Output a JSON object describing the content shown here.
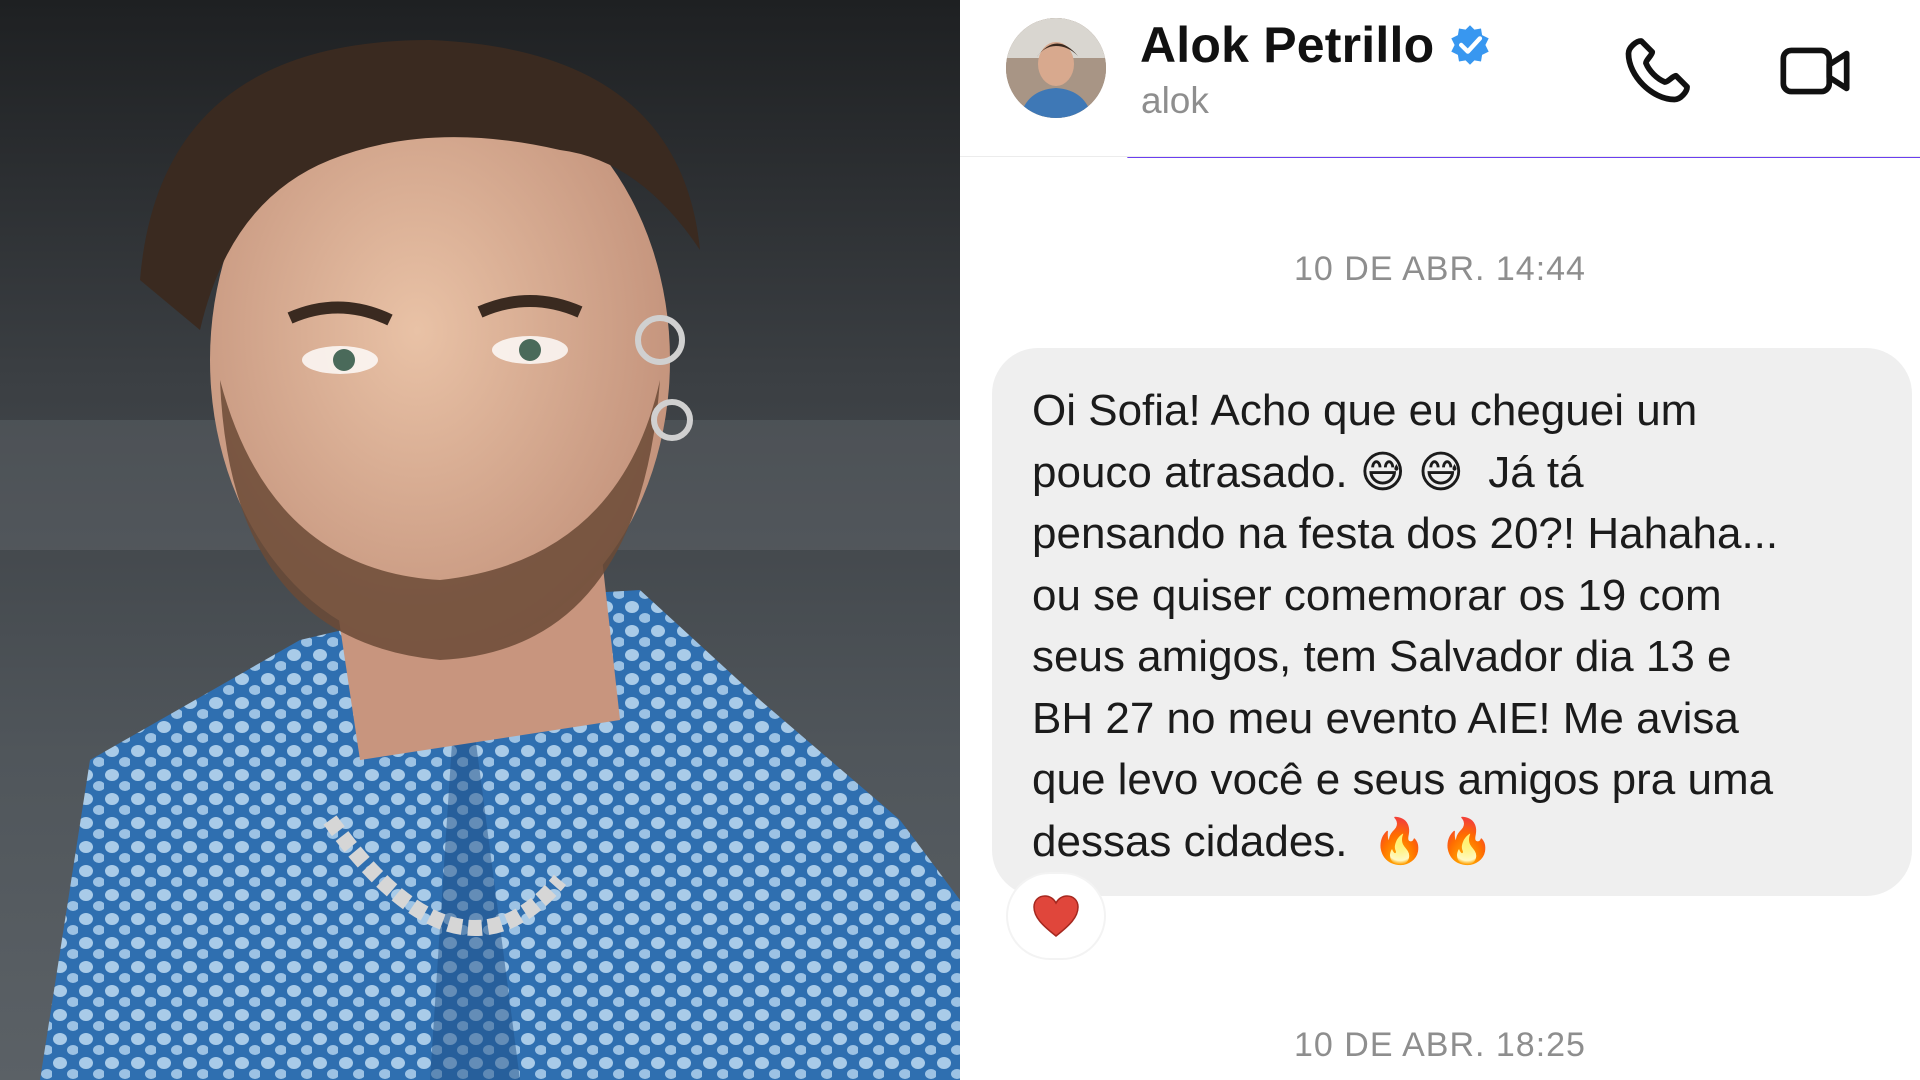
{
  "photo": {
    "alt_subject": "portrait photo"
  },
  "chat": {
    "header": {
      "contact_name": "Alok Petrillo",
      "handle": "alok",
      "verified_icon": "verified-badge-icon",
      "call_icon": "phone-icon",
      "video_icon": "video-camera-icon"
    },
    "accent_color": "#6b3ff0",
    "messages": [
      {
        "timestamp": "10 DE ABR. 14:44",
        "text": "Oi Sofia! Acho que eu cheguei um\npouco atrasado. 😅 😅  Já tá\npensando na festa dos 20?! Hahaha...\nou se quiser comemorar os 19 com\nseus amigos, tem Salvador dia 13 e\nBH 27 no meu evento AIE! Me avisa\nque levo você e seus amigos pra uma\ndessas cidades.  🔥 🔥",
        "reaction": "heart-icon"
      }
    ],
    "next_timestamp": "10 DE ABR. 18:25"
  }
}
